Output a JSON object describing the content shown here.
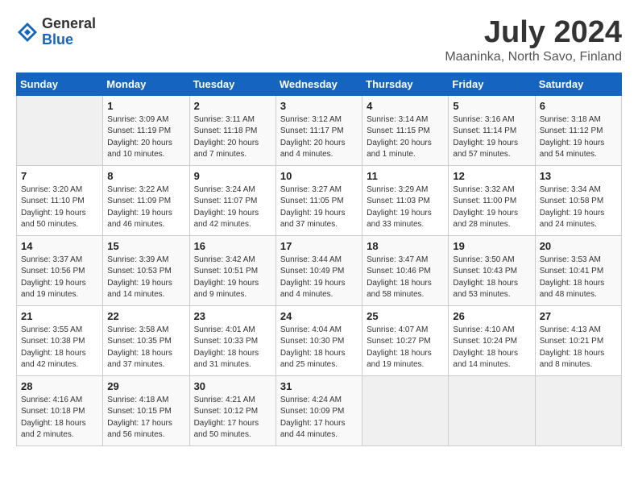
{
  "logo": {
    "general": "General",
    "blue": "Blue"
  },
  "title": "July 2024",
  "subtitle": "Maaninka, North Savo, Finland",
  "weekdays": [
    "Sunday",
    "Monday",
    "Tuesday",
    "Wednesday",
    "Thursday",
    "Friday",
    "Saturday"
  ],
  "weeks": [
    [
      {
        "day": "",
        "info": ""
      },
      {
        "day": "1",
        "info": "Sunrise: 3:09 AM\nSunset: 11:19 PM\nDaylight: 20 hours\nand 10 minutes."
      },
      {
        "day": "2",
        "info": "Sunrise: 3:11 AM\nSunset: 11:18 PM\nDaylight: 20 hours\nand 7 minutes."
      },
      {
        "day": "3",
        "info": "Sunrise: 3:12 AM\nSunset: 11:17 PM\nDaylight: 20 hours\nand 4 minutes."
      },
      {
        "day": "4",
        "info": "Sunrise: 3:14 AM\nSunset: 11:15 PM\nDaylight: 20 hours\nand 1 minute."
      },
      {
        "day": "5",
        "info": "Sunrise: 3:16 AM\nSunset: 11:14 PM\nDaylight: 19 hours\nand 57 minutes."
      },
      {
        "day": "6",
        "info": "Sunrise: 3:18 AM\nSunset: 11:12 PM\nDaylight: 19 hours\nand 54 minutes."
      }
    ],
    [
      {
        "day": "7",
        "info": "Sunrise: 3:20 AM\nSunset: 11:10 PM\nDaylight: 19 hours\nand 50 minutes."
      },
      {
        "day": "8",
        "info": "Sunrise: 3:22 AM\nSunset: 11:09 PM\nDaylight: 19 hours\nand 46 minutes."
      },
      {
        "day": "9",
        "info": "Sunrise: 3:24 AM\nSunset: 11:07 PM\nDaylight: 19 hours\nand 42 minutes."
      },
      {
        "day": "10",
        "info": "Sunrise: 3:27 AM\nSunset: 11:05 PM\nDaylight: 19 hours\nand 37 minutes."
      },
      {
        "day": "11",
        "info": "Sunrise: 3:29 AM\nSunset: 11:03 PM\nDaylight: 19 hours\nand 33 minutes."
      },
      {
        "day": "12",
        "info": "Sunrise: 3:32 AM\nSunset: 11:00 PM\nDaylight: 19 hours\nand 28 minutes."
      },
      {
        "day": "13",
        "info": "Sunrise: 3:34 AM\nSunset: 10:58 PM\nDaylight: 19 hours\nand 24 minutes."
      }
    ],
    [
      {
        "day": "14",
        "info": "Sunrise: 3:37 AM\nSunset: 10:56 PM\nDaylight: 19 hours\nand 19 minutes."
      },
      {
        "day": "15",
        "info": "Sunrise: 3:39 AM\nSunset: 10:53 PM\nDaylight: 19 hours\nand 14 minutes."
      },
      {
        "day": "16",
        "info": "Sunrise: 3:42 AM\nSunset: 10:51 PM\nDaylight: 19 hours\nand 9 minutes."
      },
      {
        "day": "17",
        "info": "Sunrise: 3:44 AM\nSunset: 10:49 PM\nDaylight: 19 hours\nand 4 minutes."
      },
      {
        "day": "18",
        "info": "Sunrise: 3:47 AM\nSunset: 10:46 PM\nDaylight: 18 hours\nand 58 minutes."
      },
      {
        "day": "19",
        "info": "Sunrise: 3:50 AM\nSunset: 10:43 PM\nDaylight: 18 hours\nand 53 minutes."
      },
      {
        "day": "20",
        "info": "Sunrise: 3:53 AM\nSunset: 10:41 PM\nDaylight: 18 hours\nand 48 minutes."
      }
    ],
    [
      {
        "day": "21",
        "info": "Sunrise: 3:55 AM\nSunset: 10:38 PM\nDaylight: 18 hours\nand 42 minutes."
      },
      {
        "day": "22",
        "info": "Sunrise: 3:58 AM\nSunset: 10:35 PM\nDaylight: 18 hours\nand 37 minutes."
      },
      {
        "day": "23",
        "info": "Sunrise: 4:01 AM\nSunset: 10:33 PM\nDaylight: 18 hours\nand 31 minutes."
      },
      {
        "day": "24",
        "info": "Sunrise: 4:04 AM\nSunset: 10:30 PM\nDaylight: 18 hours\nand 25 minutes."
      },
      {
        "day": "25",
        "info": "Sunrise: 4:07 AM\nSunset: 10:27 PM\nDaylight: 18 hours\nand 19 minutes."
      },
      {
        "day": "26",
        "info": "Sunrise: 4:10 AM\nSunset: 10:24 PM\nDaylight: 18 hours\nand 14 minutes."
      },
      {
        "day": "27",
        "info": "Sunrise: 4:13 AM\nSunset: 10:21 PM\nDaylight: 18 hours\nand 8 minutes."
      }
    ],
    [
      {
        "day": "28",
        "info": "Sunrise: 4:16 AM\nSunset: 10:18 PM\nDaylight: 18 hours\nand 2 minutes."
      },
      {
        "day": "29",
        "info": "Sunrise: 4:18 AM\nSunset: 10:15 PM\nDaylight: 17 hours\nand 56 minutes."
      },
      {
        "day": "30",
        "info": "Sunrise: 4:21 AM\nSunset: 10:12 PM\nDaylight: 17 hours\nand 50 minutes."
      },
      {
        "day": "31",
        "info": "Sunrise: 4:24 AM\nSunset: 10:09 PM\nDaylight: 17 hours\nand 44 minutes."
      },
      {
        "day": "",
        "info": ""
      },
      {
        "day": "",
        "info": ""
      },
      {
        "day": "",
        "info": ""
      }
    ]
  ]
}
